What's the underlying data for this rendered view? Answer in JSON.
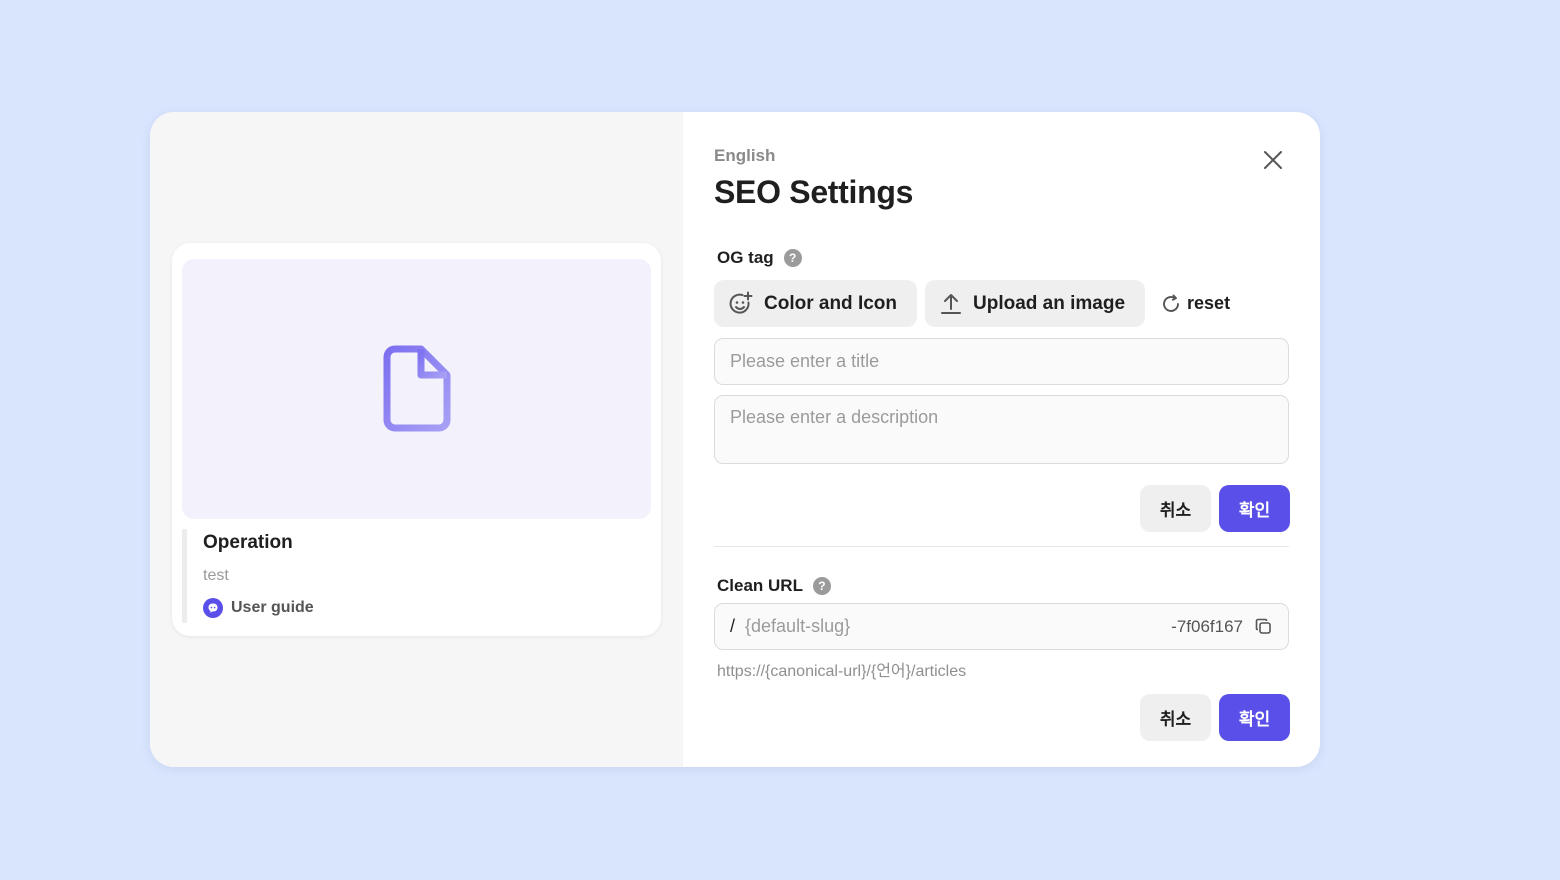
{
  "preview": {
    "card_title": "Operation",
    "card_description": "test",
    "category_label": "User guide",
    "category_color": "#5a4fe8",
    "thumbnail_icon": "file-icon",
    "thumbnail_icon_color": "#8f82f0"
  },
  "dialog": {
    "language": "English",
    "title": "SEO Settings",
    "close_icon": "close-icon"
  },
  "og": {
    "label": "OG tag",
    "help_icon": "question-circle-icon",
    "help_glyph": "?",
    "color_icon_label": "Color and Icon",
    "upload_label": "Upload an image",
    "reset_label": "reset",
    "title_placeholder": "Please enter a title",
    "description_placeholder": "Please enter a description",
    "cancel_label": "취소",
    "confirm_label": "확인"
  },
  "clean_url": {
    "label": "Clean URL",
    "help_glyph": "?",
    "prefix": "/",
    "slug_placeholder": "{default-slug}",
    "suffix": "-7f06f167",
    "hint": "https://{canonical-url}/{언어}/articles",
    "cancel_label": "취소",
    "confirm_label": "확인"
  },
  "colors": {
    "background": "#d9e5fd",
    "accent": "#5a4fe8",
    "button_neutral": "#efeff0"
  }
}
